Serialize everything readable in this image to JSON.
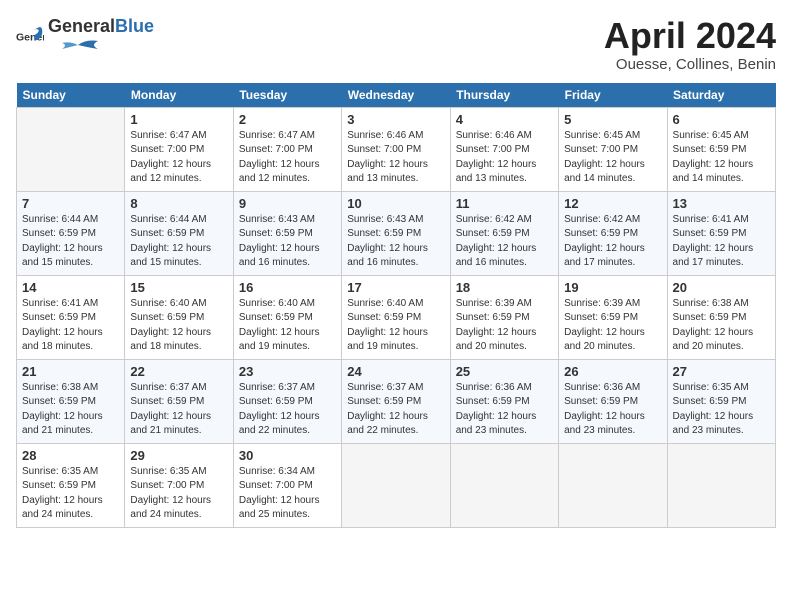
{
  "header": {
    "logo_general": "General",
    "logo_blue": "Blue",
    "title": "April 2024",
    "subtitle": "Ouesse, Collines, Benin"
  },
  "weekdays": [
    "Sunday",
    "Monday",
    "Tuesday",
    "Wednesday",
    "Thursday",
    "Friday",
    "Saturday"
  ],
  "weeks": [
    [
      {
        "day": null
      },
      {
        "day": "1",
        "sunrise": "6:47 AM",
        "sunset": "7:00 PM",
        "daylight": "12 hours and 12 minutes."
      },
      {
        "day": "2",
        "sunrise": "6:47 AM",
        "sunset": "7:00 PM",
        "daylight": "12 hours and 12 minutes."
      },
      {
        "day": "3",
        "sunrise": "6:46 AM",
        "sunset": "7:00 PM",
        "daylight": "12 hours and 13 minutes."
      },
      {
        "day": "4",
        "sunrise": "6:46 AM",
        "sunset": "7:00 PM",
        "daylight": "12 hours and 13 minutes."
      },
      {
        "day": "5",
        "sunrise": "6:45 AM",
        "sunset": "7:00 PM",
        "daylight": "12 hours and 14 minutes."
      },
      {
        "day": "6",
        "sunrise": "6:45 AM",
        "sunset": "6:59 PM",
        "daylight": "12 hours and 14 minutes."
      }
    ],
    [
      {
        "day": "7",
        "sunrise": "6:44 AM",
        "sunset": "6:59 PM",
        "daylight": "12 hours and 15 minutes."
      },
      {
        "day": "8",
        "sunrise": "6:44 AM",
        "sunset": "6:59 PM",
        "daylight": "12 hours and 15 minutes."
      },
      {
        "day": "9",
        "sunrise": "6:43 AM",
        "sunset": "6:59 PM",
        "daylight": "12 hours and 16 minutes."
      },
      {
        "day": "10",
        "sunrise": "6:43 AM",
        "sunset": "6:59 PM",
        "daylight": "12 hours and 16 minutes."
      },
      {
        "day": "11",
        "sunrise": "6:42 AM",
        "sunset": "6:59 PM",
        "daylight": "12 hours and 16 minutes."
      },
      {
        "day": "12",
        "sunrise": "6:42 AM",
        "sunset": "6:59 PM",
        "daylight": "12 hours and 17 minutes."
      },
      {
        "day": "13",
        "sunrise": "6:41 AM",
        "sunset": "6:59 PM",
        "daylight": "12 hours and 17 minutes."
      }
    ],
    [
      {
        "day": "14",
        "sunrise": "6:41 AM",
        "sunset": "6:59 PM",
        "daylight": "12 hours and 18 minutes."
      },
      {
        "day": "15",
        "sunrise": "6:40 AM",
        "sunset": "6:59 PM",
        "daylight": "12 hours and 18 minutes."
      },
      {
        "day": "16",
        "sunrise": "6:40 AM",
        "sunset": "6:59 PM",
        "daylight": "12 hours and 19 minutes."
      },
      {
        "day": "17",
        "sunrise": "6:40 AM",
        "sunset": "6:59 PM",
        "daylight": "12 hours and 19 minutes."
      },
      {
        "day": "18",
        "sunrise": "6:39 AM",
        "sunset": "6:59 PM",
        "daylight": "12 hours and 20 minutes."
      },
      {
        "day": "19",
        "sunrise": "6:39 AM",
        "sunset": "6:59 PM",
        "daylight": "12 hours and 20 minutes."
      },
      {
        "day": "20",
        "sunrise": "6:38 AM",
        "sunset": "6:59 PM",
        "daylight": "12 hours and 20 minutes."
      }
    ],
    [
      {
        "day": "21",
        "sunrise": "6:38 AM",
        "sunset": "6:59 PM",
        "daylight": "12 hours and 21 minutes."
      },
      {
        "day": "22",
        "sunrise": "6:37 AM",
        "sunset": "6:59 PM",
        "daylight": "12 hours and 21 minutes."
      },
      {
        "day": "23",
        "sunrise": "6:37 AM",
        "sunset": "6:59 PM",
        "daylight": "12 hours and 22 minutes."
      },
      {
        "day": "24",
        "sunrise": "6:37 AM",
        "sunset": "6:59 PM",
        "daylight": "12 hours and 22 minutes."
      },
      {
        "day": "25",
        "sunrise": "6:36 AM",
        "sunset": "6:59 PM",
        "daylight": "12 hours and 23 minutes."
      },
      {
        "day": "26",
        "sunrise": "6:36 AM",
        "sunset": "6:59 PM",
        "daylight": "12 hours and 23 minutes."
      },
      {
        "day": "27",
        "sunrise": "6:35 AM",
        "sunset": "6:59 PM",
        "daylight": "12 hours and 23 minutes."
      }
    ],
    [
      {
        "day": "28",
        "sunrise": "6:35 AM",
        "sunset": "6:59 PM",
        "daylight": "12 hours and 24 minutes."
      },
      {
        "day": "29",
        "sunrise": "6:35 AM",
        "sunset": "7:00 PM",
        "daylight": "12 hours and 24 minutes."
      },
      {
        "day": "30",
        "sunrise": "6:34 AM",
        "sunset": "7:00 PM",
        "daylight": "12 hours and 25 minutes."
      },
      {
        "day": null
      },
      {
        "day": null
      },
      {
        "day": null
      },
      {
        "day": null
      }
    ]
  ]
}
